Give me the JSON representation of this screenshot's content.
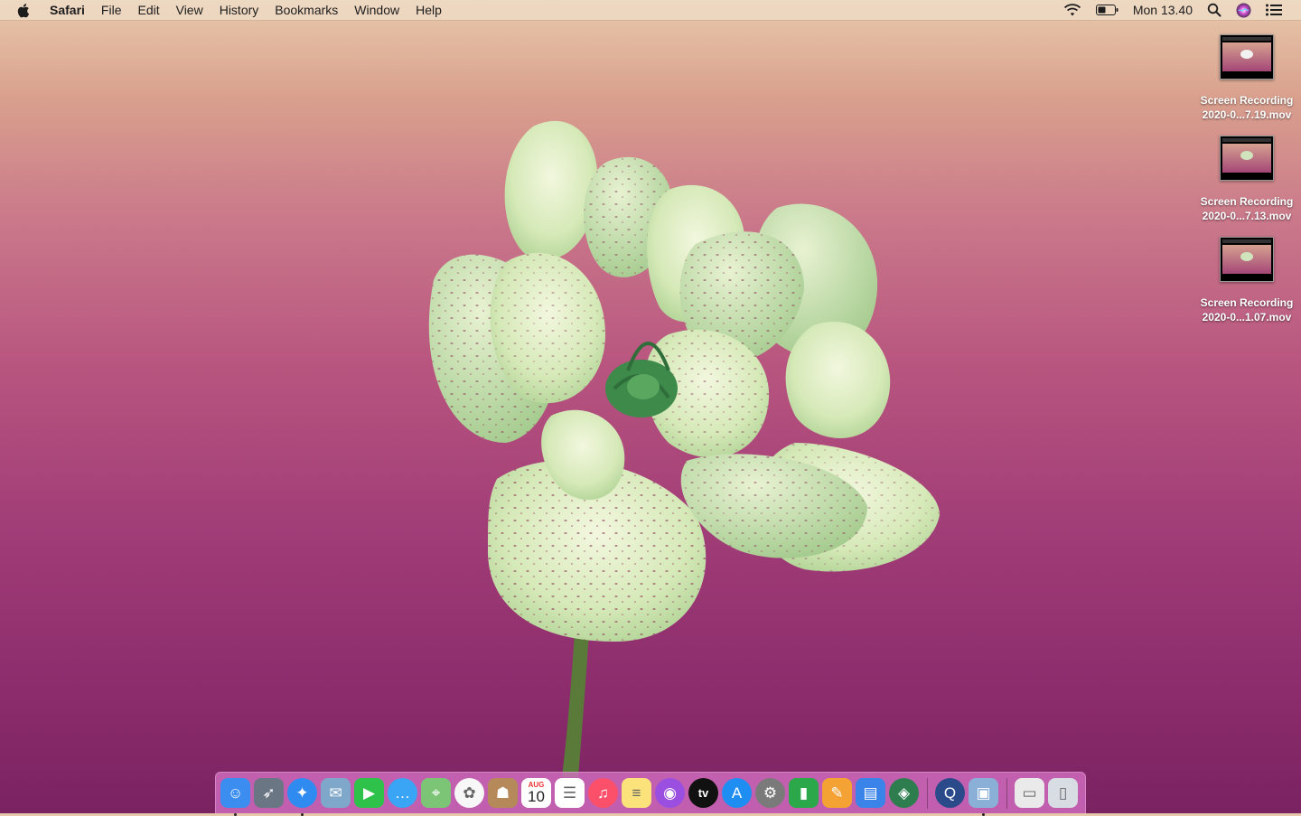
{
  "menubar": {
    "apple_icon": "apple-logo-icon",
    "app_name": "Safari",
    "items": [
      "File",
      "Edit",
      "View",
      "History",
      "Bookmarks",
      "Window",
      "Help"
    ],
    "status_icons": [
      "wifi-icon",
      "battery-icon"
    ],
    "clock": "Mon 13.40",
    "right_icons": [
      "spotlight-search-icon",
      "siri-icon",
      "notification-center-icon"
    ]
  },
  "desktop": {
    "files": [
      {
        "line1": "Screen Recording",
        "line2": "2020-0...7.19.mov"
      },
      {
        "line1": "Screen Recording",
        "line2": "2020-0...7.13.mov"
      },
      {
        "line1": "Screen Recording",
        "line2": "2020-0...1.07.mov"
      }
    ]
  },
  "dock": {
    "apps": [
      {
        "name": "Finder",
        "icon": "finder-icon",
        "color": "#3b8df0",
        "running": true
      },
      {
        "name": "Launchpad",
        "icon": "launchpad-rocket-icon",
        "color": "#6b7685",
        "running": false
      },
      {
        "name": "Safari",
        "icon": "safari-compass-icon",
        "color": "#2f8bf0",
        "running": true
      },
      {
        "name": "Mail",
        "icon": "mail-stamp-icon",
        "color": "#7fa7c9",
        "running": false
      },
      {
        "name": "FaceTime",
        "icon": "facetime-icon",
        "color": "#2fc24b",
        "running": false
      },
      {
        "name": "Messages",
        "icon": "messages-bubble-icon",
        "color": "#3aa4f5",
        "running": false
      },
      {
        "name": "Maps",
        "icon": "maps-icon",
        "color": "#7cc476",
        "running": false
      },
      {
        "name": "Photos",
        "icon": "photos-flower-icon",
        "color": "#f7f7f7",
        "running": false
      },
      {
        "name": "Contacts",
        "icon": "contacts-book-icon",
        "color": "#b6895b",
        "running": false
      },
      {
        "name": "Calendar",
        "icon": "calendar-icon",
        "color": "#ffffff",
        "running": false,
        "month": "AUG",
        "day": "10"
      },
      {
        "name": "Reminders",
        "icon": "reminders-list-icon",
        "color": "#ffffff",
        "running": false
      },
      {
        "name": "Music",
        "icon": "music-note-icon",
        "color": "#fb4f6a",
        "running": false
      },
      {
        "name": "Notes",
        "icon": "notes-icon",
        "color": "#fbe27a",
        "running": false
      },
      {
        "name": "Podcasts",
        "icon": "podcasts-icon",
        "color": "#9b4fe0",
        "running": false
      },
      {
        "name": "TV",
        "icon": "apple-tv-icon",
        "color": "#111111",
        "running": false,
        "text": "tv"
      },
      {
        "name": "App Store",
        "icon": "app-store-icon",
        "color": "#1f8ef3",
        "running": false
      },
      {
        "name": "System Preferences",
        "icon": "system-preferences-gear-icon",
        "color": "#7a7a7a",
        "running": false
      },
      {
        "name": "Numbers",
        "icon": "numbers-chart-icon",
        "color": "#2aa84a",
        "running": false
      },
      {
        "name": "Pages",
        "icon": "pages-pen-icon",
        "color": "#f3a233",
        "running": false
      },
      {
        "name": "Keynote",
        "icon": "keynote-podium-icon",
        "color": "#3a83e8",
        "running": false
      },
      {
        "name": "Android Studio",
        "icon": "android-studio-icon",
        "color": "#2e7d4f",
        "running": false
      }
    ],
    "secondary": [
      {
        "name": "QuickTime Player",
        "icon": "quicktime-icon",
        "color": "#2a4a8a",
        "running": false
      },
      {
        "name": "Preview",
        "icon": "preview-photos-icon",
        "color": "#8ab0d8",
        "running": true
      }
    ],
    "tertiary": [
      {
        "name": "Downloads",
        "icon": "downloads-stack-icon",
        "color": "#eaeaea",
        "running": false
      },
      {
        "name": "Trash",
        "icon": "trash-icon",
        "color": "#d8dde3",
        "running": false
      }
    ]
  }
}
